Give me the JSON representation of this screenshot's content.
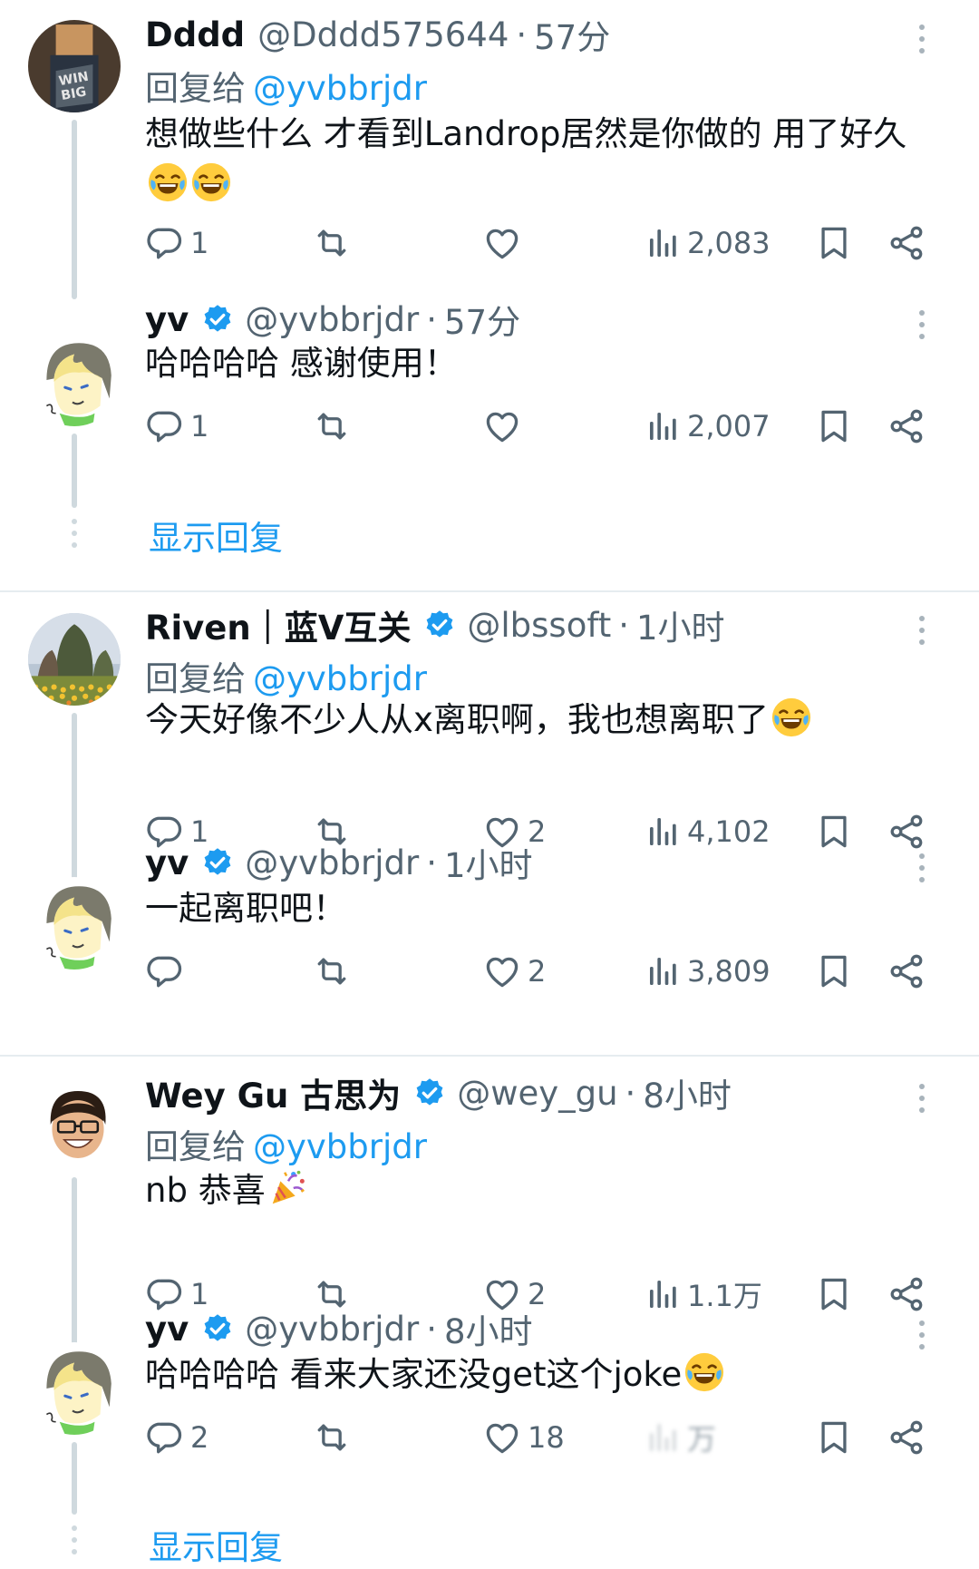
{
  "threads": [
    {
      "parent": {
        "name": "Dddd",
        "handle": "@Dddd575644",
        "sep": "·",
        "time": "57分",
        "reply_prefix": "回复给",
        "reply_to": "@yvbbrjdr",
        "text": "想做些什么 才看到Landrop居然是你做的 用了好久",
        "emoji": [
          "face-with-tears-of-joy",
          "face-with-tears-of-joy"
        ],
        "stats": {
          "replies": "1",
          "retweets": "",
          "likes": "",
          "views": "2,083"
        }
      },
      "reply": {
        "name": "yv",
        "handle": "@yvbbrjdr",
        "sep": "·",
        "time": "57分",
        "text": "哈哈哈哈 感谢使用！",
        "stats": {
          "replies": "1",
          "retweets": "",
          "likes": "",
          "views": "2,007"
        }
      },
      "show_replies": "显示回复"
    },
    {
      "parent": {
        "name": "Riven｜蓝V互关",
        "handle": "@lbssoft",
        "sep": "·",
        "time": "1小时",
        "reply_prefix": "回复给",
        "reply_to": "@yvbbrjdr",
        "text": "今天好像不少人从x离职啊，我也想离职了",
        "emoji": [
          "face-with-tears-of-joy"
        ],
        "stats": {
          "replies": "1",
          "retweets": "",
          "likes": "2",
          "views": "4,102"
        }
      },
      "reply": {
        "name": "yv",
        "handle": "@yvbbrjdr",
        "sep": "·",
        "time": "1小时",
        "text": "一起离职吧！",
        "stats": {
          "replies": "",
          "retweets": "",
          "likes": "2",
          "views": "3,809"
        }
      }
    },
    {
      "parent": {
        "name": "Wey Gu 古思为",
        "handle": "@wey_gu",
        "sep": "·",
        "time": "8小时",
        "reply_prefix": "回复给",
        "reply_to": "@yvbbrjdr",
        "text": "nb 恭喜",
        "emoji": [
          "party-popper"
        ],
        "stats": {
          "replies": "1",
          "retweets": "",
          "likes": "2",
          "views": "1.1万"
        }
      },
      "reply": {
        "name": "yv",
        "handle": "@yvbbrjdr",
        "sep": "·",
        "time": "8小时",
        "text": "哈哈哈哈 看来大家还没get这个joke",
        "emoji": [
          "face-with-tears-of-joy"
        ],
        "stats": {
          "replies": "2",
          "retweets": "",
          "likes": "18",
          "views": "万"
        }
      },
      "show_replies": "显示回复"
    }
  ],
  "colors": {
    "link": "#1d9bf0",
    "muted": "#536471",
    "text": "#0f1419",
    "thread_line": "#cfd9de",
    "verified": "#1d9bf0"
  },
  "icons": [
    "reply-icon",
    "retweet-icon",
    "like-icon",
    "views-icon",
    "bookmark-icon",
    "share-icon",
    "more-icon",
    "verified-badge-icon"
  ]
}
